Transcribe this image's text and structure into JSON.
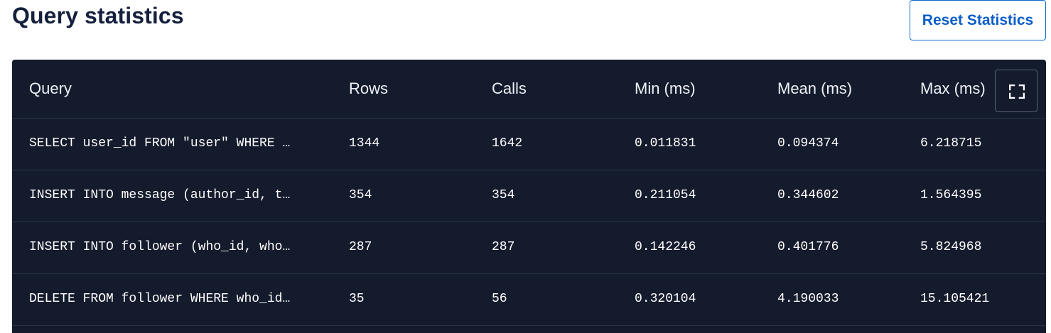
{
  "header": {
    "title": "Query statistics",
    "reset_label": "Reset Statistics"
  },
  "table": {
    "columns": [
      "Query",
      "Rows",
      "Calls",
      "Min (ms)",
      "Mean (ms)",
      "Max (ms)"
    ],
    "expand_icon": "fullscreen-icon",
    "rows": [
      [
        "SELECT user_id FROM \"user\" WHERE …",
        "1344",
        "1642",
        "0.011831",
        "0.094374",
        "6.218715"
      ],
      [
        "INSERT INTO message (author_id, t…",
        "354",
        "354",
        "0.211054",
        "0.344602",
        "1.564395"
      ],
      [
        "INSERT INTO follower (who_id, who…",
        "287",
        "287",
        "0.142246",
        "0.401776",
        "5.824968"
      ],
      [
        "DELETE FROM follower WHERE who_id…",
        "35",
        "56",
        "0.320104",
        "4.190033",
        "15.105421"
      ]
    ]
  },
  "colors": {
    "title": "#14203d",
    "accent": "#0b5ec9",
    "table_bg": "#141b2d",
    "row_divider": "#2a3347"
  }
}
